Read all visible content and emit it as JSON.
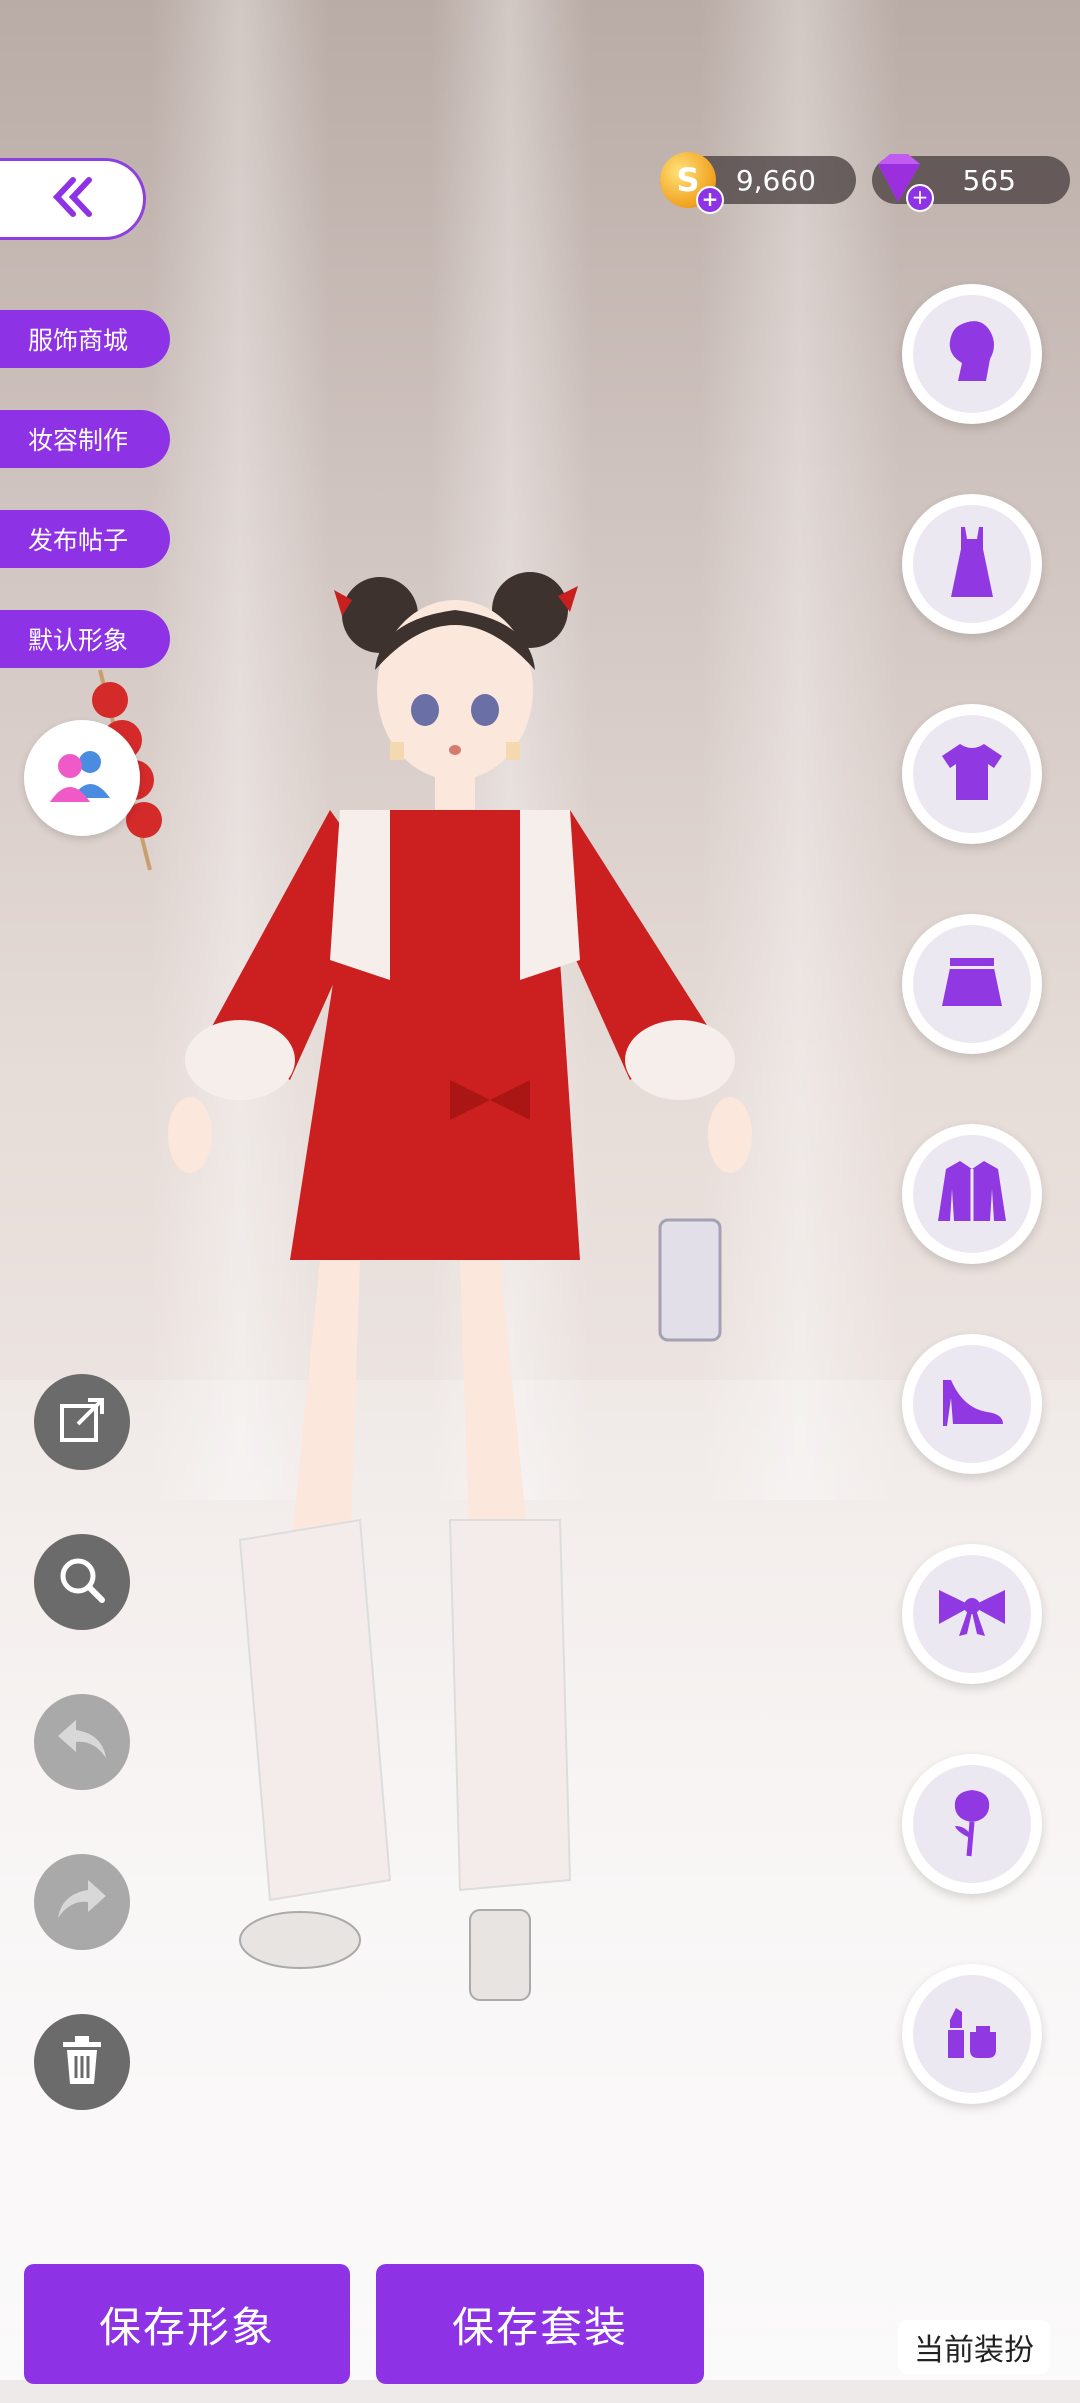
{
  "currency": {
    "gold": "9,660",
    "gems": "565",
    "gold_icon_letter": "S",
    "plus": "+"
  },
  "side_menu": [
    {
      "label": "服饰商城"
    },
    {
      "label": "妆容制作"
    },
    {
      "label": "发布帖子"
    },
    {
      "label": "默认形象"
    }
  ],
  "categories": [
    {
      "icon": "hair-icon"
    },
    {
      "icon": "dress-icon"
    },
    {
      "icon": "top-icon"
    },
    {
      "icon": "skirt-icon"
    },
    {
      "icon": "jacket-icon"
    },
    {
      "icon": "high-heel-icon"
    },
    {
      "icon": "bow-icon"
    },
    {
      "icon": "rose-icon"
    },
    {
      "icon": "makeup-icon"
    }
  ],
  "bottom": {
    "save_look": "保存形象",
    "save_outfit": "保存套装",
    "current_outfit": "当前装扮"
  },
  "colors": {
    "accent": "#8e32e6",
    "dress": "#cc1f1f"
  }
}
